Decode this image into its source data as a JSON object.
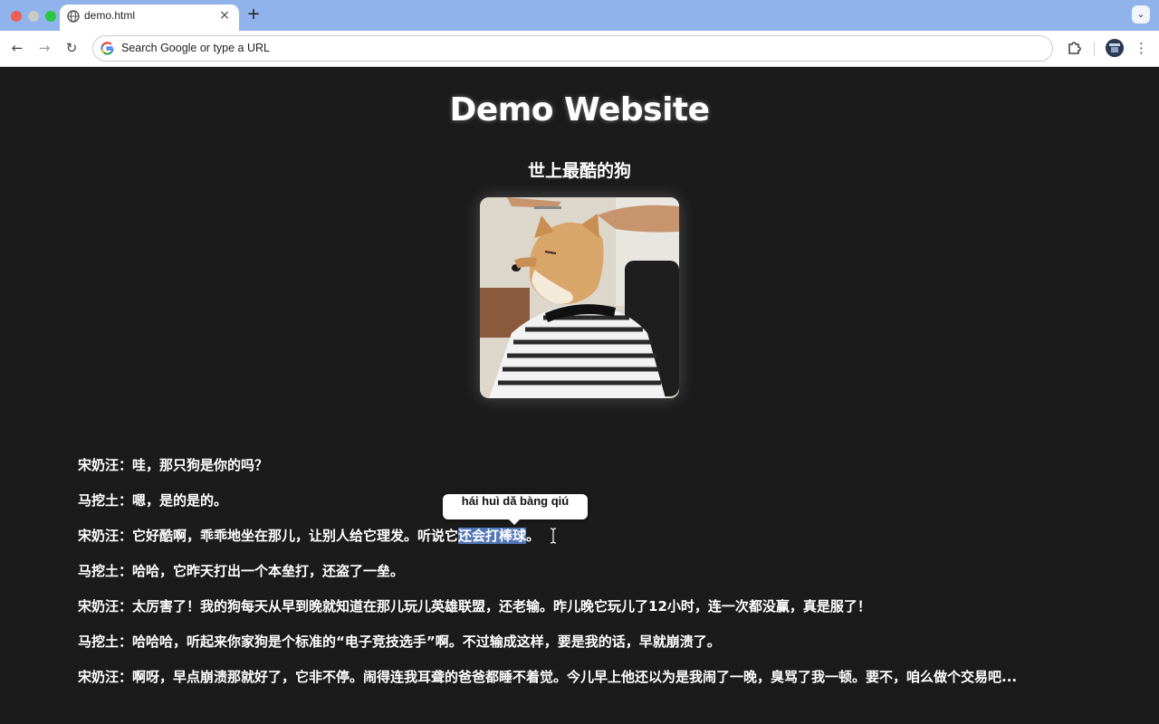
{
  "browser": {
    "tab": {
      "title": "demo.html",
      "close_glyph": "×"
    },
    "new_tab_glyph": "+",
    "tab_menu_glyph": "⌄",
    "omnibox": {
      "placeholder": "Search Google or type a URL"
    },
    "nav": {
      "back": "←",
      "forward": "→",
      "reload": "↻",
      "menu": "⋮"
    }
  },
  "page": {
    "title": "Demo Website",
    "subtitle": "世上最酷的狗",
    "image_alt": "Shiba Inu dog getting a haircut",
    "tooltip": "hái huì dǎ bàng qiú",
    "dialogue": [
      {
        "text": "宋奶汪：哇，那只狗是你的吗？"
      },
      {
        "text": "马挖土：嗯，是的是的。"
      },
      {
        "before": "宋奶汪：它好酷啊，乖乖地坐在那儿，让别人给它理发。听说它",
        "highlight": "还会打棒球",
        "after": "。"
      },
      {
        "text": "马挖土：哈哈，它昨天打出一个本垒打，还盗了一垒。"
      },
      {
        "text": "宋奶汪：太厉害了！我的狗每天从早到晚就知道在那儿玩儿英雄联盟，还老输。昨儿晚它玩儿了12小时，连一次都没赢，真是服了！"
      },
      {
        "text": "马挖土：哈哈哈，听起来你家狗是个标准的“电子竞技选手”啊。不过输成这样，要是我的话，早就崩溃了。"
      },
      {
        "text": "宋奶汪：啊呀，早点崩溃那就好了，它非不停。闹得连我耳聋的爸爸都睡不着觉。今儿早上他还以为是我闹了一晚，臭骂了我一顿。要不，咱么做个交易吧..."
      }
    ]
  },
  "colors": {
    "page_bg": "#1b1b1b",
    "tabbar_bg": "#8fb3ea",
    "highlight": "#5277b8"
  }
}
